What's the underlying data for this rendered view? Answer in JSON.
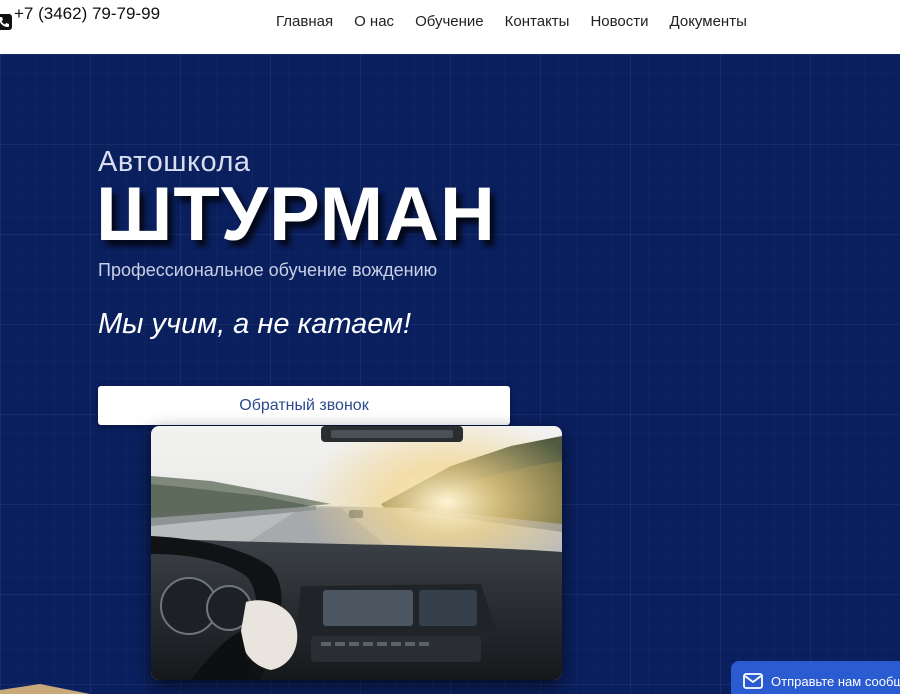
{
  "header": {
    "phone": "+7 (3462) 79-79-99",
    "nav": [
      "Главная",
      "О нас",
      "Обучение",
      "Контакты",
      "Новости",
      "Документы"
    ]
  },
  "hero": {
    "pre_title": "Автошкола",
    "title": "ШТУРМАН",
    "subtitle": "Профессиональное обучение вождению",
    "slogan": "Мы учим, а не катаем!",
    "cta_label": "Обратный звонок"
  },
  "widget": {
    "label": "Отправьте нам сообщение"
  },
  "icons": {
    "phone": "phone-icon",
    "mail": "mail-icon"
  },
  "colors": {
    "hero_bg": "#0a1f5e",
    "cta_text": "#2c4a8c",
    "widget_bg": "#2a5bd0"
  }
}
